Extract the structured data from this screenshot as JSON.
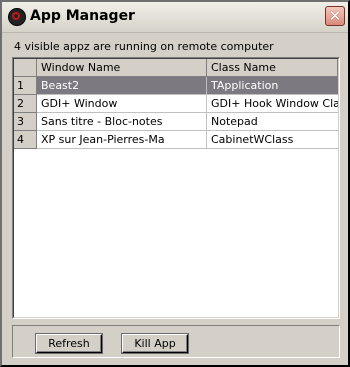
{
  "window": {
    "title": "App Manager",
    "close_glyph": "✕",
    "icon": "app-icon"
  },
  "status_text": "4 visible appz are running on remote computer",
  "table": {
    "columns": [
      "",
      "Window Name",
      "Class Name"
    ],
    "rows": [
      {
        "index": "1",
        "window_name": "Beast2",
        "class_name": "TApplication",
        "selected": true
      },
      {
        "index": "2",
        "window_name": "GDI+ Window",
        "class_name": "GDI+ Hook Window Class"
      },
      {
        "index": "3",
        "window_name": "Sans titre - Bloc-notes",
        "class_name": "Notepad"
      },
      {
        "index": "4",
        "window_name": "XP sur Jean-Pierres-Ma",
        "class_name": "CabinetWClass"
      }
    ]
  },
  "buttons": {
    "refresh": "Refresh",
    "kill_app": "Kill App"
  },
  "colors": {
    "selection": "#7c7a80",
    "dialog_bg": "#d4d0c8"
  }
}
